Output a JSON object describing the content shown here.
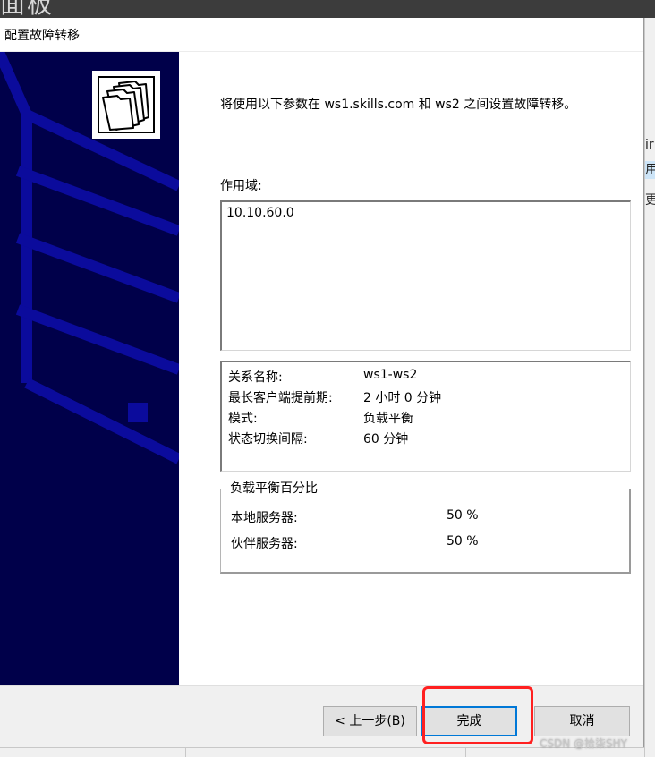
{
  "background": {
    "top_text": "面板",
    "right_cells": [
      "ir",
      "用域",
      "更"
    ]
  },
  "dialog": {
    "title": "配置故障转移",
    "intro": "将使用以下参数在 ws1.skills.com 和 ws2 之间设置故障转移。",
    "scope_label": "作用域:",
    "scopes": [
      "10.10.60.0"
    ],
    "summary": [
      {
        "key": "关系名称:",
        "value": "ws1-ws2"
      },
      {
        "key": "最长客户端提前期:",
        "value": "2 小时 0 分钟"
      },
      {
        "key": "模式:",
        "value": "负载平衡"
      },
      {
        "key": "状态切换间隔:",
        "value": "60 分钟"
      }
    ],
    "load_balance": {
      "legend": "负载平衡百分比",
      "local_label": "本地服务器:",
      "local_value": "50 %",
      "partner_label": "伙伴服务器:",
      "partner_value": "50 %"
    },
    "buttons": {
      "back": "< 上一步(B)",
      "finish": "完成",
      "cancel": "取消"
    }
  },
  "annotation": {
    "color": "#ff2020"
  },
  "colors": {
    "banner": "#00004a",
    "banner_lines": "#0b0b9c",
    "focus": "#0078d7"
  },
  "watermark": "CSDN @拾柒SHY"
}
